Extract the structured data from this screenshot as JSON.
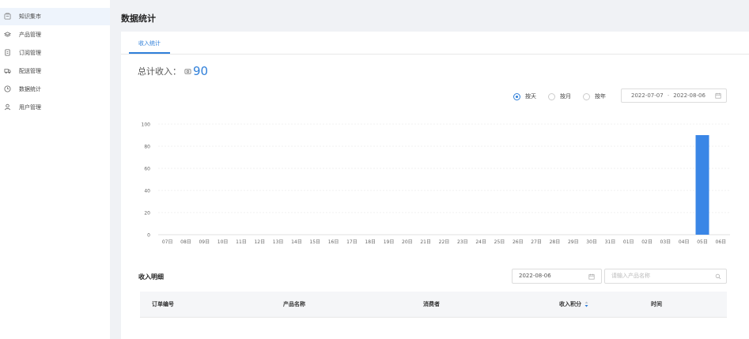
{
  "sidebar": {
    "items": [
      {
        "label": "知识集市",
        "icon": "shop-icon"
      },
      {
        "label": "产品管理",
        "icon": "layers-icon"
      },
      {
        "label": "订阅管理",
        "icon": "document-icon"
      },
      {
        "label": "配送管理",
        "icon": "truck-icon"
      },
      {
        "label": "数据统计",
        "icon": "clock-icon"
      },
      {
        "label": "用户管理",
        "icon": "user-icon"
      }
    ],
    "active_index": 0
  },
  "page": {
    "title": "数据统计"
  },
  "tabs": [
    {
      "label": "收入统计"
    }
  ],
  "summary": {
    "total_label": "总计收入：",
    "total_value": "90"
  },
  "period": {
    "options": [
      {
        "label": "按天",
        "selected": true
      },
      {
        "label": "按月",
        "selected": false
      },
      {
        "label": "按年",
        "selected": false
      }
    ],
    "start": "2022-07-07",
    "separator": "-",
    "end": "2022-08-06"
  },
  "chart_data": {
    "type": "bar",
    "categories": [
      "07日",
      "08日",
      "09日",
      "10日",
      "11日",
      "12日",
      "13日",
      "14日",
      "15日",
      "16日",
      "17日",
      "18日",
      "19日",
      "20日",
      "21日",
      "22日",
      "23日",
      "24日",
      "25日",
      "26日",
      "27日",
      "28日",
      "29日",
      "30日",
      "31日",
      "01日",
      "02日",
      "03日",
      "04日",
      "05日",
      "06日"
    ],
    "values": [
      0,
      0,
      0,
      0,
      0,
      0,
      0,
      0,
      0,
      0,
      0,
      0,
      0,
      0,
      0,
      0,
      0,
      0,
      0,
      0,
      0,
      0,
      0,
      0,
      0,
      0,
      0,
      0,
      0,
      90,
      0
    ],
    "yticks": [
      "0",
      "20",
      "40",
      "60",
      "80",
      "100"
    ],
    "ylim": [
      0,
      100
    ],
    "grid": true,
    "bar_color": "#3a86e6"
  },
  "detail": {
    "title": "收入明细",
    "date": "2022-08-06",
    "search_placeholder": "请输入产品名称",
    "columns": [
      "订单编号",
      "产品名称",
      "消费者",
      "收入积分",
      "时间"
    ]
  },
  "colors": {
    "accent": "#2f7fd9"
  }
}
